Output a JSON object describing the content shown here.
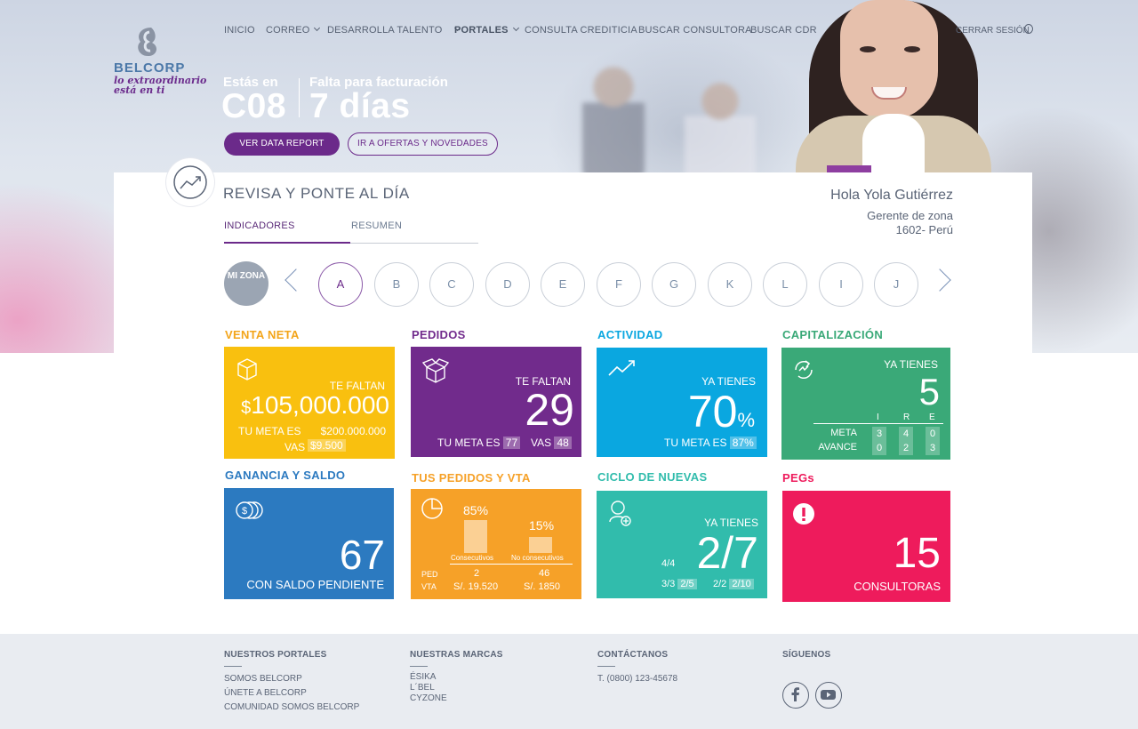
{
  "brand": {
    "name": "BELCORP",
    "tagline_line1": "lo extraordinario",
    "tagline_line2": "está en ti"
  },
  "nav": {
    "items": [
      {
        "label": "INICIO"
      },
      {
        "label": "CORREO"
      },
      {
        "label": "DESARROLLA TALENTO"
      },
      {
        "label": "PORTALES"
      },
      {
        "label": "CONSULTA CREDITICIA"
      },
      {
        "label": "BUSCAR CONSULTORA"
      },
      {
        "label": "BUSCAR CDR"
      }
    ],
    "logout": "CERRAR SESIÓN"
  },
  "campaign": {
    "label": "Estás en",
    "value": "C08",
    "billing_label": "Falta para facturación",
    "billing_value": "7 días"
  },
  "actions": {
    "primary": "VER DATA REPORT",
    "secondary": "IR A OFERTAS Y NOVEDADES"
  },
  "main": {
    "title": "REVISA Y PONTE AL DÍA",
    "tabs": [
      "INDICADORES",
      "RESUMEN"
    ],
    "greeting": {
      "name": "Hola Yola Gutiérrez",
      "role": "Gerente de zona",
      "location": "1602- Perú"
    }
  },
  "zones": {
    "mine": "MI ZONA",
    "items": [
      "A",
      "B",
      "C",
      "D",
      "E",
      "F",
      "G",
      "K",
      "L",
      "I",
      "J"
    ],
    "selected": "A"
  },
  "tiles": {
    "venta": {
      "title": "VENTA NETA",
      "label": "TE FALTAN",
      "currency": "$",
      "value": "105,000.000",
      "meta_label": "TU META ES",
      "meta_value": "$200.000.000",
      "vas_label": "VAS",
      "vas_value": "$9.500"
    },
    "pedidos": {
      "title": "PEDIDOS",
      "label": "TE FALTAN",
      "value": "29",
      "meta_label": "TU META ES",
      "meta_value": "77",
      "vas_label": "VAS",
      "vas_value": "48"
    },
    "actividad": {
      "title": "ACTIVIDAD",
      "label": "YA TIENES",
      "value": "70",
      "unit": "%",
      "meta_label": "TU META ES",
      "meta_value": "87%"
    },
    "capitalizacion": {
      "title": "CAPITALIZACIÓN",
      "label": "YA TIENES",
      "value": "5",
      "cols": [
        "I",
        "R",
        "E"
      ],
      "rows": [
        {
          "label": "META",
          "values": [
            "3",
            "4",
            "0"
          ]
        },
        {
          "label": "AVANCE",
          "values": [
            "0",
            "2",
            "3"
          ]
        }
      ]
    },
    "ganancia": {
      "title": "GANANCIA Y SALDO",
      "value": "67",
      "label": "CON SALDO PENDIENTE"
    },
    "tus_pedidos": {
      "title": "TUS PEDIDOS Y VTA",
      "bar1_pct": "85%",
      "bar1_label": "Consecutivos",
      "bar2_pct": "15%",
      "bar2_label": "No consecutivos",
      "ped_label": "PED",
      "vta_label": "VTA",
      "ped1": "2",
      "ped2": "46",
      "vta1": "S/. 19.520",
      "vta2": "S/. 1850",
      "bar1_fraction": 0.85,
      "bar2_fraction": 0.15
    },
    "ciclo": {
      "title": "CICLO DE NUEVAS",
      "label": "YA TIENES",
      "value": "2/7",
      "s1": "4/4",
      "s2": "3/3",
      "s2b": "2/5",
      "s3": "2/2",
      "s3b": "2/10"
    },
    "pegs": {
      "title": "PEGs",
      "value": "15",
      "label": "CONSULTORAS"
    }
  },
  "colors": {
    "primary": "#6b2a8a",
    "yellow": "#f9c00f",
    "purple": "#712b8c",
    "blue": "#0aa7e0",
    "green": "#3aa978",
    "navy": "#2c7ac0",
    "orange": "#f6a128",
    "teal": "#31bcac",
    "pink": "#ee1b5c"
  },
  "footer": {
    "portales": {
      "title": "NUESTROS PORTALES",
      "links": [
        "SOMOS BELCORP",
        "ÚNETE A BELCORP",
        "COMUNIDAD SOMOS BELCORP"
      ]
    },
    "marcas": {
      "title": "NUESTRAS MARCAS",
      "links": [
        "ÉSIKA",
        "L´BEL",
        "CYZONE"
      ]
    },
    "contacto": {
      "title": "CONTÁCTANOS",
      "phone": "T. (0800) 123-45678"
    },
    "siguenos": {
      "title": "SÍGUENOS",
      "icons": [
        "facebook-icon",
        "youtube-icon"
      ]
    }
  }
}
